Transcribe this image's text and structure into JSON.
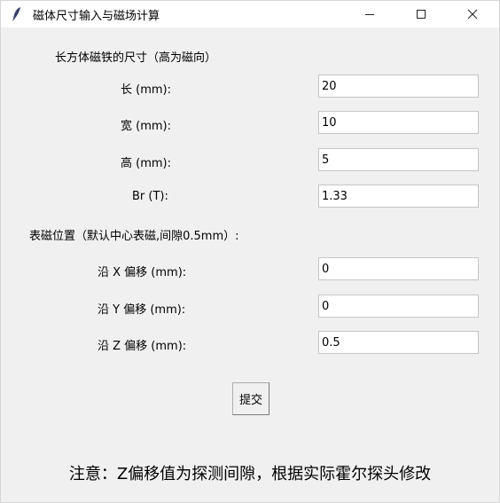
{
  "window": {
    "title": "磁体尺寸输入与磁场计算",
    "minimize_symbol": "—",
    "maximize_symbol": "☐",
    "close_symbol": "✕"
  },
  "section_dimensions": {
    "heading": "长方体磁铁的尺寸（高为磁向）",
    "length_label": "长 (mm):",
    "length_value": "20",
    "width_label": "宽 (mm):",
    "width_value": "10",
    "height_label": "高 (mm):",
    "height_value": "5",
    "br_label": "Br (T):",
    "br_value": "1.33"
  },
  "section_position": {
    "heading": "表磁位置（默认中心表磁,间隙0.5mm）:",
    "x_label": "沿 X 偏移 (mm):",
    "x_value": "0",
    "y_label": "沿 Y 偏移 (mm):",
    "y_value": "0",
    "z_label": "沿 Z 偏移 (mm):",
    "z_value": "0.5"
  },
  "submit_label": "提交",
  "note": "注意：Z偏移值为探测间隙，根据实际霍尔探头修改"
}
